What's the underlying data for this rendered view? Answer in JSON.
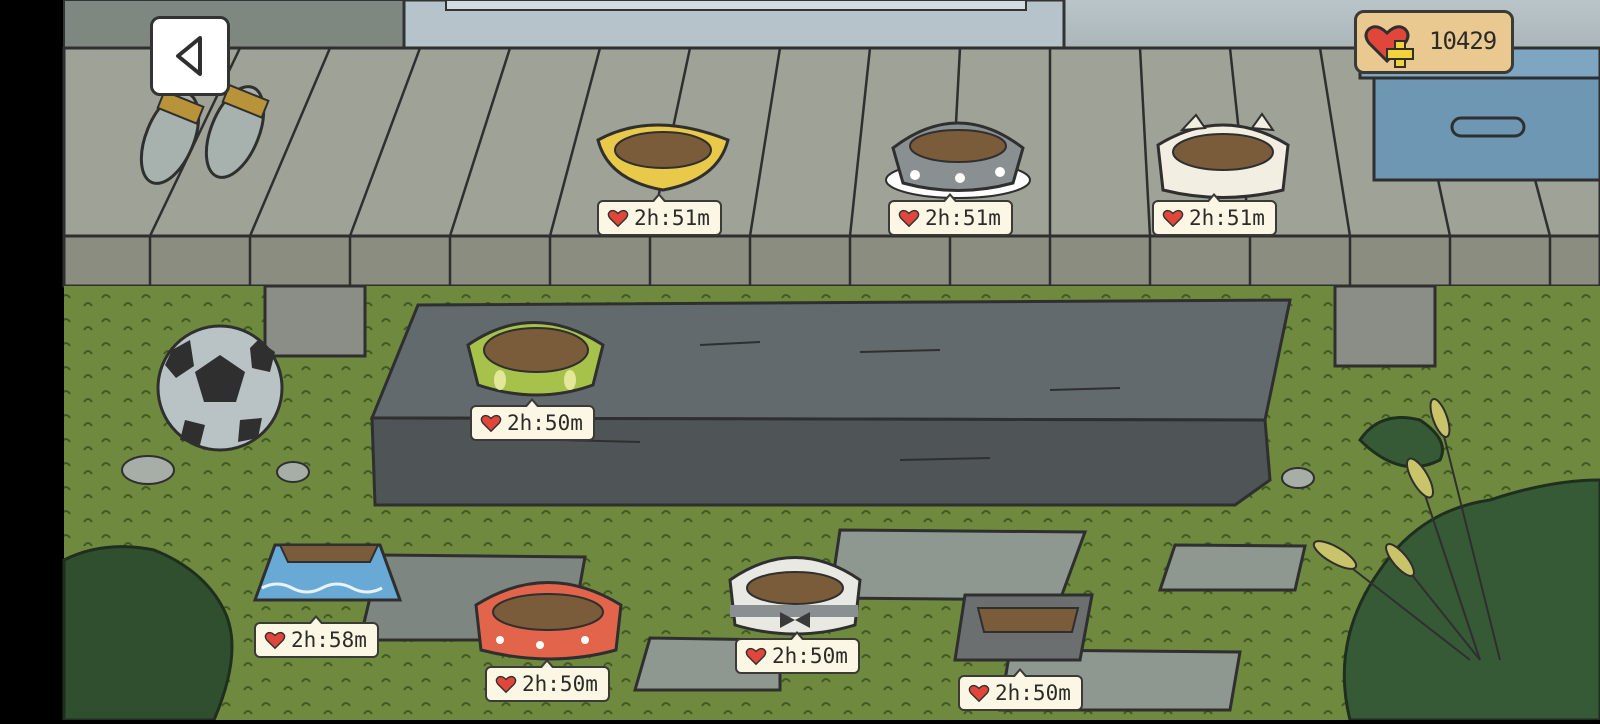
{
  "hud": {
    "currency_value": "10429",
    "back_icon": "chevron-left-icon",
    "currency_icon": "heart-plus-icon"
  },
  "bowls": [
    {
      "name": "yellow-bowl",
      "timer": "2h:51m"
    },
    {
      "name": "gray-polka-bowl",
      "timer": "2h:51m"
    },
    {
      "name": "cat-ear-bowl",
      "timer": "2h:51m"
    },
    {
      "name": "green-leaf-bowl",
      "timer": "2h:50m"
    },
    {
      "name": "blue-wave-bowl",
      "timer": "2h:58m"
    },
    {
      "name": "orange-polka-bowl",
      "timer": "2h:50m"
    },
    {
      "name": "bow-tie-bowl",
      "timer": "2h:50m"
    },
    {
      "name": "gray-square-bowl",
      "timer": "2h:50m"
    }
  ],
  "colors": {
    "grass": "#6f8a3e",
    "deck": "#9b9e92",
    "stone": "#5b6165",
    "heart": "#e0463a",
    "badge": "#fbf7e4"
  }
}
